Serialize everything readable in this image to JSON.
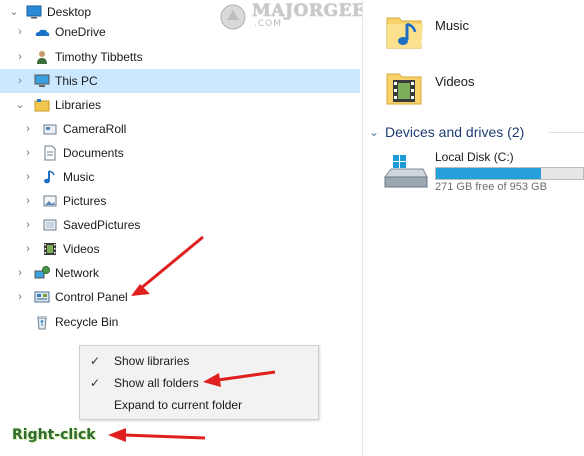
{
  "nav": {
    "items": [
      {
        "label": "Desktop",
        "icon": "desktop-icon",
        "chevron": "down",
        "selected": false
      },
      {
        "label": "OneDrive",
        "icon": "onedrive-icon",
        "chevron": "right",
        "selected": false
      },
      {
        "label": "Timothy Tibbetts",
        "icon": "user-folder-icon",
        "chevron": "right",
        "selected": false
      },
      {
        "label": "This PC",
        "icon": "this-pc-icon",
        "chevron": "right",
        "selected": true
      },
      {
        "label": "Libraries",
        "icon": "libraries-icon",
        "chevron": "down",
        "selected": false
      },
      {
        "label": "CameraRoll",
        "icon": "cameraroll-library-icon",
        "chevron": "right",
        "selected": false
      },
      {
        "label": "Documents",
        "icon": "documents-library-icon",
        "chevron": "right",
        "selected": false
      },
      {
        "label": "Music",
        "icon": "music-library-icon",
        "chevron": "right",
        "selected": false
      },
      {
        "label": "Pictures",
        "icon": "pictures-library-icon",
        "chevron": "right",
        "selected": false
      },
      {
        "label": "SavedPictures",
        "icon": "savedpictures-library-icon",
        "chevron": "right",
        "selected": false
      },
      {
        "label": "Videos",
        "icon": "videos-library-icon",
        "chevron": "right",
        "selected": false
      },
      {
        "label": "Network",
        "icon": "network-icon",
        "chevron": "right",
        "selected": false
      },
      {
        "label": "Control Panel",
        "icon": "control-panel-icon",
        "chevron": "right",
        "selected": false
      },
      {
        "label": "Recycle Bin",
        "icon": "recycle-bin-icon",
        "chevron": "none",
        "selected": false
      }
    ]
  },
  "context_menu": {
    "items": [
      {
        "label": "Show libraries",
        "checked": true
      },
      {
        "label": "Show all folders",
        "checked": true
      },
      {
        "label": "Expand to current folder",
        "checked": false
      }
    ]
  },
  "content": {
    "folders": [
      {
        "label": "Music",
        "icon": "music-folder-icon"
      },
      {
        "label": "Videos",
        "icon": "videos-folder-icon"
      }
    ],
    "devices_section": {
      "title": "Devices and drives (2)"
    },
    "drive": {
      "name": "Local Disk (C:)",
      "free_text": "271 GB free of 953 GB",
      "used_fraction": 0.716
    }
  },
  "annotations": {
    "right_click_label": "Right-click",
    "watermark_text": "MAJORGEEKS",
    "watermark_sub": ".COM",
    "arrow_color": "#e0201e"
  },
  "colors": {
    "selection": "#cce8ff",
    "drive_bar_fill": "#26a0da",
    "section_title": "#1e3d73"
  }
}
